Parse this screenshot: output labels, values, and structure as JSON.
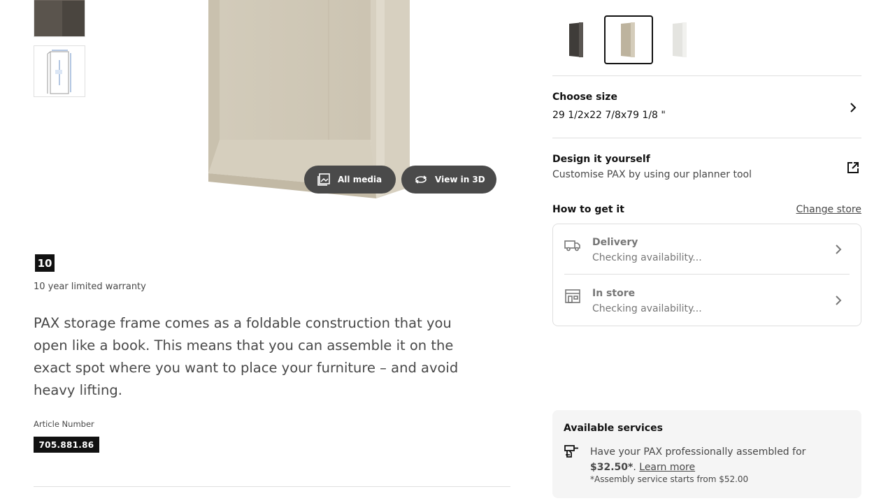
{
  "gallery": {
    "all_media_label": "All media",
    "view_3d_label": "View in 3D"
  },
  "warranty": {
    "years": "10",
    "text": "10 year limited warranty"
  },
  "description": "PAX storage frame comes as a foldable construction that you open like a book. This means that you can assemble it on the exact spot where you want to place your furniture – and avoid heavy lifting.",
  "article": {
    "label": "Article Number",
    "number": "705.881.86"
  },
  "color_options": [
    {
      "name": "dark-brown",
      "color": "#4d4a47",
      "selected": false
    },
    {
      "name": "beige",
      "color": "#cfc6b2",
      "selected": true
    },
    {
      "name": "white",
      "color": "#ececea",
      "selected": false
    }
  ],
  "size": {
    "title": "Choose size",
    "value": "29 1/2x22 7/8x79 1/8 \""
  },
  "design": {
    "title": "Design it yourself",
    "subtitle": "Customise PAX by using our planner tool"
  },
  "how_to_get": {
    "title": "How to get it",
    "change_store": "Change store",
    "delivery": {
      "title": "Delivery",
      "status": "Checking availability...",
      "icon": "truck-icon"
    },
    "in_store": {
      "title": "In store",
      "status": "Checking availability...",
      "icon": "store-icon"
    }
  },
  "services": {
    "title": "Available services",
    "text_prefix": "Have your PAX professionally assembled for",
    "price": "$32.50*",
    "learn_more": "Learn more",
    "note": "*Assembly service starts from $52.00",
    "icon": "drill-icon"
  }
}
